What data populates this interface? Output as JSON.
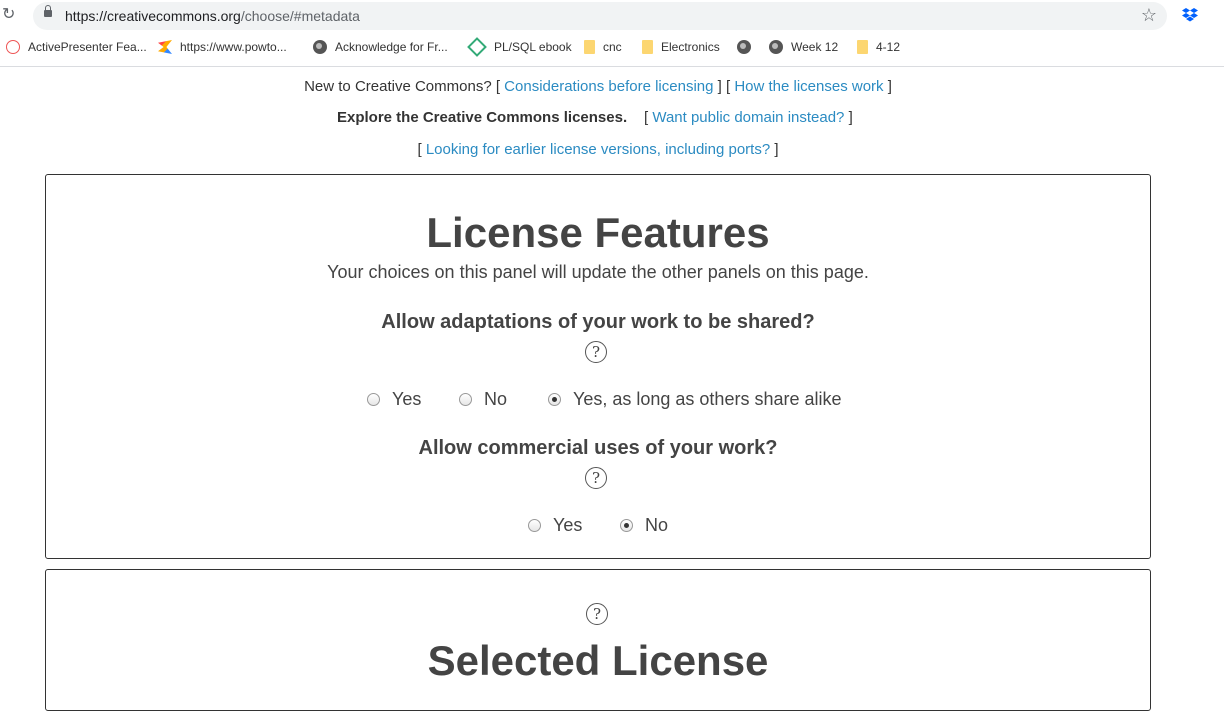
{
  "browser": {
    "url_host": "https://creativecommons.org",
    "url_path": "/choose/#metadata",
    "bookmarks": [
      {
        "label": "ActivePresenter Fea...",
        "icon": "activepresenter-icon"
      },
      {
        "label": "https://www.powto...",
        "icon": "powtoon-icon"
      },
      {
        "label": "Acknowledge for Fr...",
        "icon": "globe-icon"
      },
      {
        "label": "PL/SQL ebook",
        "icon": "diamond-icon"
      },
      {
        "label": "cnc",
        "icon": "folder-icon"
      },
      {
        "label": "Electronics",
        "icon": "folder-icon"
      },
      {
        "label": "",
        "icon": "globe-icon"
      },
      {
        "label": "Week 12",
        "icon": "globe-icon"
      },
      {
        "label": "4-12",
        "icon": "folder-icon"
      }
    ]
  },
  "intro": {
    "new_to": "New to Creative Commons? [",
    "considerations": "Considerations before licensing",
    "sep": " ] [ ",
    "how_work": "How the licenses work",
    "close": " ]",
    "explore": "Explore the Creative Commons licenses.",
    "pd_open": "[ ",
    "public_domain": "Want public domain instead?",
    "pd_close": " ]",
    "earlier_open": "[ ",
    "earlier": "Looking for earlier license versions, including ports?",
    "earlier_close": " ]"
  },
  "features": {
    "title": "License Features",
    "subtitle": "Your choices on this panel will update the other panels on this page.",
    "q1": "Allow adaptations of your work to be shared?",
    "q1_options": [
      "Yes",
      "No",
      "Yes, as long as others share alike"
    ],
    "q1_selected": 2,
    "q2": "Allow commercial uses of your work?",
    "q2_options": [
      "Yes",
      "No"
    ],
    "q2_selected": 1,
    "help_glyph": "?"
  },
  "selected": {
    "title": "Selected License",
    "help_glyph": "?"
  }
}
